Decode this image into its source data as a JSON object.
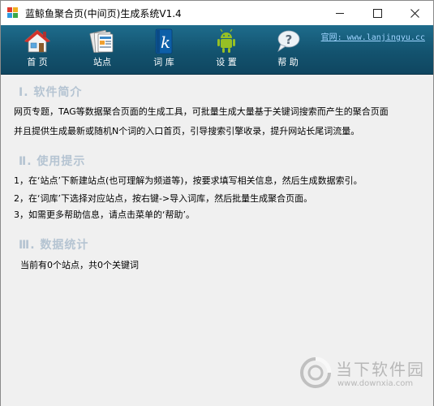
{
  "window": {
    "title": "蓝鲸鱼聚合页(中间页)生成系统V1.4"
  },
  "toolbar": {
    "items": [
      {
        "label": "首 页",
        "icon": "home-icon"
      },
      {
        "label": "站点",
        "icon": "sites-icon"
      },
      {
        "label": "词 库",
        "icon": "keyword-library-icon"
      },
      {
        "label": "设 置",
        "icon": "android-settings-icon"
      },
      {
        "label": "帮 助",
        "icon": "help-icon"
      }
    ],
    "site_link": "官网: www.lanjingyu.cc"
  },
  "content": {
    "sections": [
      {
        "title": "Ⅰ. 软件简介",
        "lines": [
          "网页专题，TAG等数据聚合页面的生成工具，可批量生成大量基于关键词搜索而产生的聚合页面",
          "并且提供生成最新或随机N个词的入口首页，引导搜索引擎收录，提升网站长尾词流量。"
        ]
      },
      {
        "title": "Ⅱ. 使用提示",
        "lines": [
          "1，在‘站点’下新建站点(也可理解为频道等)，按要求填写相关信息，然后生成数据索引。",
          "2，在‘词库’下选择对应站点，按右键->导入词库，然后批量生成聚合页面。",
          "3，如需更多帮助信息，请点击菜单的‘帮助’。"
        ]
      },
      {
        "title": "Ⅲ. 数据统计",
        "lines": [
          "当前有0个站点，共0个关键词"
        ]
      }
    ]
  },
  "watermark": {
    "brand": "当下软件园",
    "url": "www.downxia.com"
  }
}
